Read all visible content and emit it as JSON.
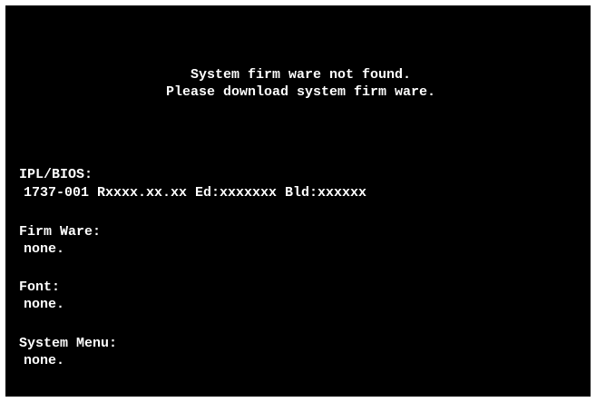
{
  "message": {
    "line1": "System firm ware not found.",
    "line2": "Please download system firm ware."
  },
  "sections": [
    {
      "label": "IPL/BIOS:",
      "value": "1737-001 Rxxxx.xx.xx Ed:xxxxxxx Bld:xxxxxx"
    },
    {
      "label": "Firm Ware:",
      "value": "none."
    },
    {
      "label": "Font:",
      "value": "none."
    },
    {
      "label": "System Menu:",
      "value": "none."
    }
  ],
  "colors": {
    "background": "#000000",
    "text": "#ffffff",
    "frame": "#ffffff"
  }
}
